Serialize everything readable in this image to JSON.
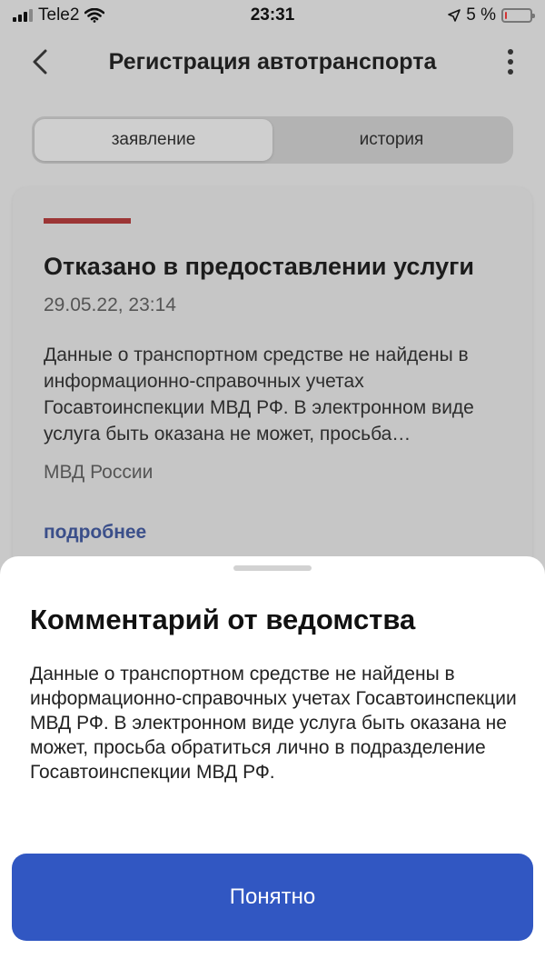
{
  "status_bar": {
    "carrier": "Tele2",
    "time": "23:31",
    "battery": "5 %",
    "battery_level": 0.05,
    "battery_color": "#d33333"
  },
  "header": {
    "title": "Регистрация автотранспорта",
    "back_icon": "chevron-left-icon",
    "more_icon": "more-vertical-icon"
  },
  "tabs": [
    {
      "label": "заявление",
      "active": true
    },
    {
      "label": "история",
      "active": false
    }
  ],
  "card": {
    "accent_color": "#c0392b",
    "title": "Отказано в предоставлении услуги",
    "date": "29.05.22, 23:14",
    "text": "Данные о транспортном средстве не найдены в информационно-справочных учетах Госавтоинспекции МВД РФ. В электронном виде услуга быть оказана не может, просьба…",
    "source": "МВД России",
    "link": "подробнее"
  },
  "sheet": {
    "title": "Комментарий от ведомства",
    "text": "Данные о транспортном средстве не найдены в информационно-справочных учетах Госавтоинспекции МВД РФ. В электронном виде услуга быть оказана не может, просьба обратиться лично в подразделение Госавтоинспекции МВД РФ.",
    "button_label": "Понятно",
    "button_color": "#3157c2"
  }
}
